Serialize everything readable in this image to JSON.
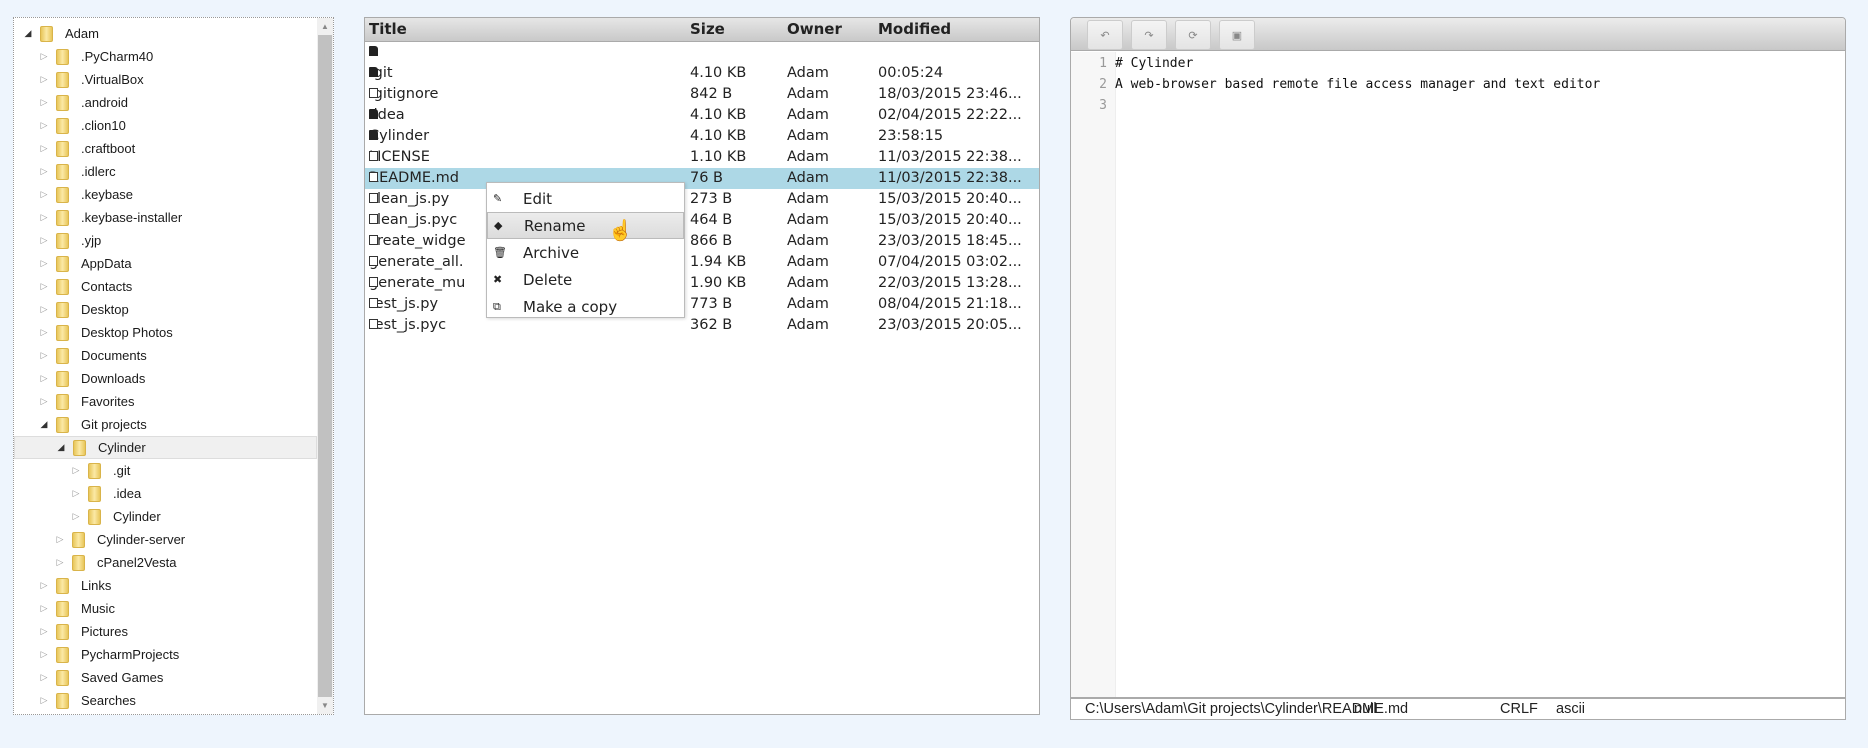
{
  "tree": {
    "items": [
      {
        "label": "Adam",
        "level": 0,
        "open": true
      },
      {
        "label": ".PyCharm40",
        "level": 1
      },
      {
        "label": ".VirtualBox",
        "level": 1
      },
      {
        "label": ".android",
        "level": 1
      },
      {
        "label": ".clion10",
        "level": 1
      },
      {
        "label": ".craftboot",
        "level": 1
      },
      {
        "label": ".idlerc",
        "level": 1
      },
      {
        "label": ".keybase",
        "level": 1
      },
      {
        "label": ".keybase-installer",
        "level": 1
      },
      {
        "label": ".yjp",
        "level": 1
      },
      {
        "label": "AppData",
        "level": 1
      },
      {
        "label": "Contacts",
        "level": 1
      },
      {
        "label": "Desktop",
        "level": 1
      },
      {
        "label": "Desktop Photos",
        "level": 1
      },
      {
        "label": "Documents",
        "level": 1
      },
      {
        "label": "Downloads",
        "level": 1
      },
      {
        "label": "Favorites",
        "level": 1
      },
      {
        "label": "Git projects",
        "level": 1,
        "open": true
      },
      {
        "label": "Cylinder",
        "level": 2,
        "open": true,
        "selected": true
      },
      {
        "label": ".git",
        "level": 3
      },
      {
        "label": ".idea",
        "level": 3
      },
      {
        "label": "Cylinder",
        "level": 3
      },
      {
        "label": "Cylinder-server",
        "level": 2
      },
      {
        "label": "cPanel2Vesta",
        "level": 2
      },
      {
        "label": "Links",
        "level": 1
      },
      {
        "label": "Music",
        "level": 1
      },
      {
        "label": "Pictures",
        "level": 1
      },
      {
        "label": "PycharmProjects",
        "level": 1
      },
      {
        "label": "Saved Games",
        "level": 1
      },
      {
        "label": "Searches",
        "level": 1
      }
    ]
  },
  "files": {
    "columns": [
      "Title",
      "Size",
      "Owner",
      "Modified"
    ],
    "rows": [
      {
        "type": "dir",
        "name": "..",
        "size": "",
        "owner": "",
        "modified": ""
      },
      {
        "type": "dir",
        "name": ".git",
        "size": "4.10 KB",
        "owner": "Adam",
        "modified": "00:05:24"
      },
      {
        "type": "file",
        "name": ".gitignore",
        "size": "842 B",
        "owner": "Adam",
        "modified": "18/03/2015 23:46..."
      },
      {
        "type": "dir",
        "name": ".idea",
        "size": "4.10 KB",
        "owner": "Adam",
        "modified": "02/04/2015 22:22..."
      },
      {
        "type": "dir",
        "name": "Cylinder",
        "size": "4.10 KB",
        "owner": "Adam",
        "modified": "23:58:15"
      },
      {
        "type": "file",
        "name": "LICENSE",
        "size": "1.10 KB",
        "owner": "Adam",
        "modified": "11/03/2015 22:38..."
      },
      {
        "type": "file",
        "name": "README.md",
        "size": "76 B",
        "owner": "Adam",
        "modified": "11/03/2015 22:38...",
        "selected": true
      },
      {
        "type": "file",
        "name": "clean_js.py",
        "size": "273 B",
        "owner": "Adam",
        "modified": "15/03/2015 20:40..."
      },
      {
        "type": "file",
        "name": "clean_js.pyc",
        "size": "464 B",
        "owner": "Adam",
        "modified": "15/03/2015 20:40..."
      },
      {
        "type": "file",
        "name": "create_widge",
        "size": "866 B",
        "owner": "Adam",
        "modified": "23/03/2015 18:45..."
      },
      {
        "type": "file",
        "name": "generate_all.",
        "size": "1.94 KB",
        "owner": "Adam",
        "modified": "07/04/2015 03:02..."
      },
      {
        "type": "file",
        "name": "generate_mu",
        "size": "1.90 KB",
        "owner": "Adam",
        "modified": "22/03/2015 13:28..."
      },
      {
        "type": "file",
        "name": "test_js.py",
        "size": "773 B",
        "owner": "Adam",
        "modified": "08/04/2015 21:18..."
      },
      {
        "type": "file",
        "name": "test_js.pyc",
        "size": "362 B",
        "owner": "Adam",
        "modified": "23/03/2015 20:05..."
      }
    ]
  },
  "context_menu": {
    "items": [
      {
        "label": "Edit",
        "icon": "pencil-icon",
        "glyph": "✎"
      },
      {
        "label": "Rename",
        "icon": "tag-icon",
        "glyph": "◆",
        "hover": true
      },
      {
        "label": "Archive",
        "icon": "trash-icon",
        "glyph": "🗑"
      },
      {
        "label": "Delete",
        "icon": "x-icon",
        "glyph": "✖"
      },
      {
        "label": "Make a copy",
        "icon": "copy-icon",
        "glyph": "⧉"
      }
    ]
  },
  "editor": {
    "toolbar": [
      {
        "name": "undo",
        "glyph": "↶"
      },
      {
        "name": "redo",
        "glyph": "↷"
      },
      {
        "name": "refresh",
        "glyph": "⟳"
      },
      {
        "name": "save",
        "glyph": "▣"
      }
    ],
    "lines": [
      "# Cylinder",
      "A web-browser based remote file access manager and text editor",
      ""
    ],
    "status": {
      "path": "C:\\Users\\Adam\\Git projects\\Cylinder\\README.md",
      "mode": "null",
      "eol": "CRLF",
      "encoding": "ascii"
    }
  }
}
